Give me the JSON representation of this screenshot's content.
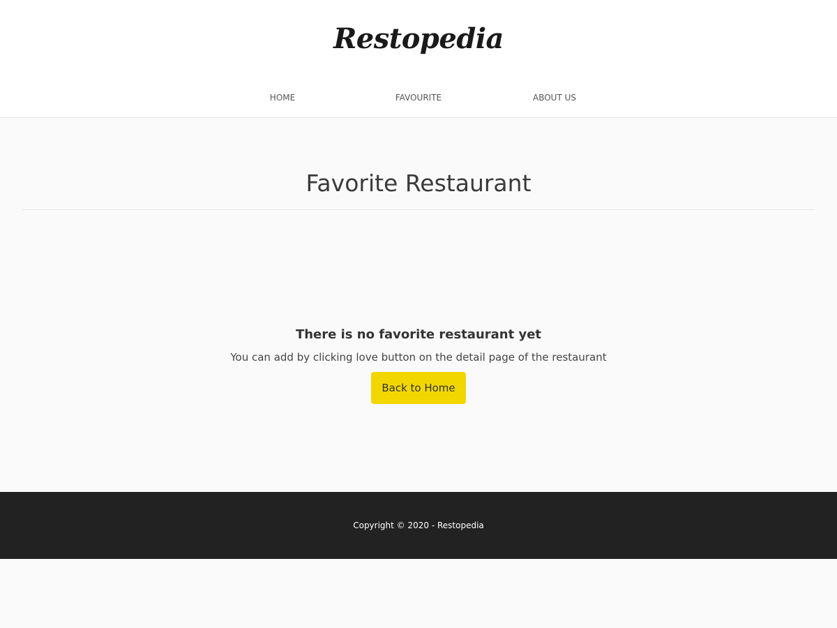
{
  "header": {
    "brand": "Restopedia",
    "nav": [
      {
        "label": "HOME"
      },
      {
        "label": "FAVOURITE"
      },
      {
        "label": "ABOUT US"
      }
    ]
  },
  "main": {
    "title": "Favorite Restaurant",
    "empty_state": {
      "heading": "There is no favorite restaurant yet",
      "description": "You can add by clicking love button on the detail page of the restaurant",
      "button_label": "Back to Home"
    }
  },
  "footer": {
    "copyright": "Copyright © 2020 - Restopedia"
  },
  "colors": {
    "accent": "#f2d600",
    "footer_bg": "#222222",
    "page_bg": "#fafafa"
  }
}
